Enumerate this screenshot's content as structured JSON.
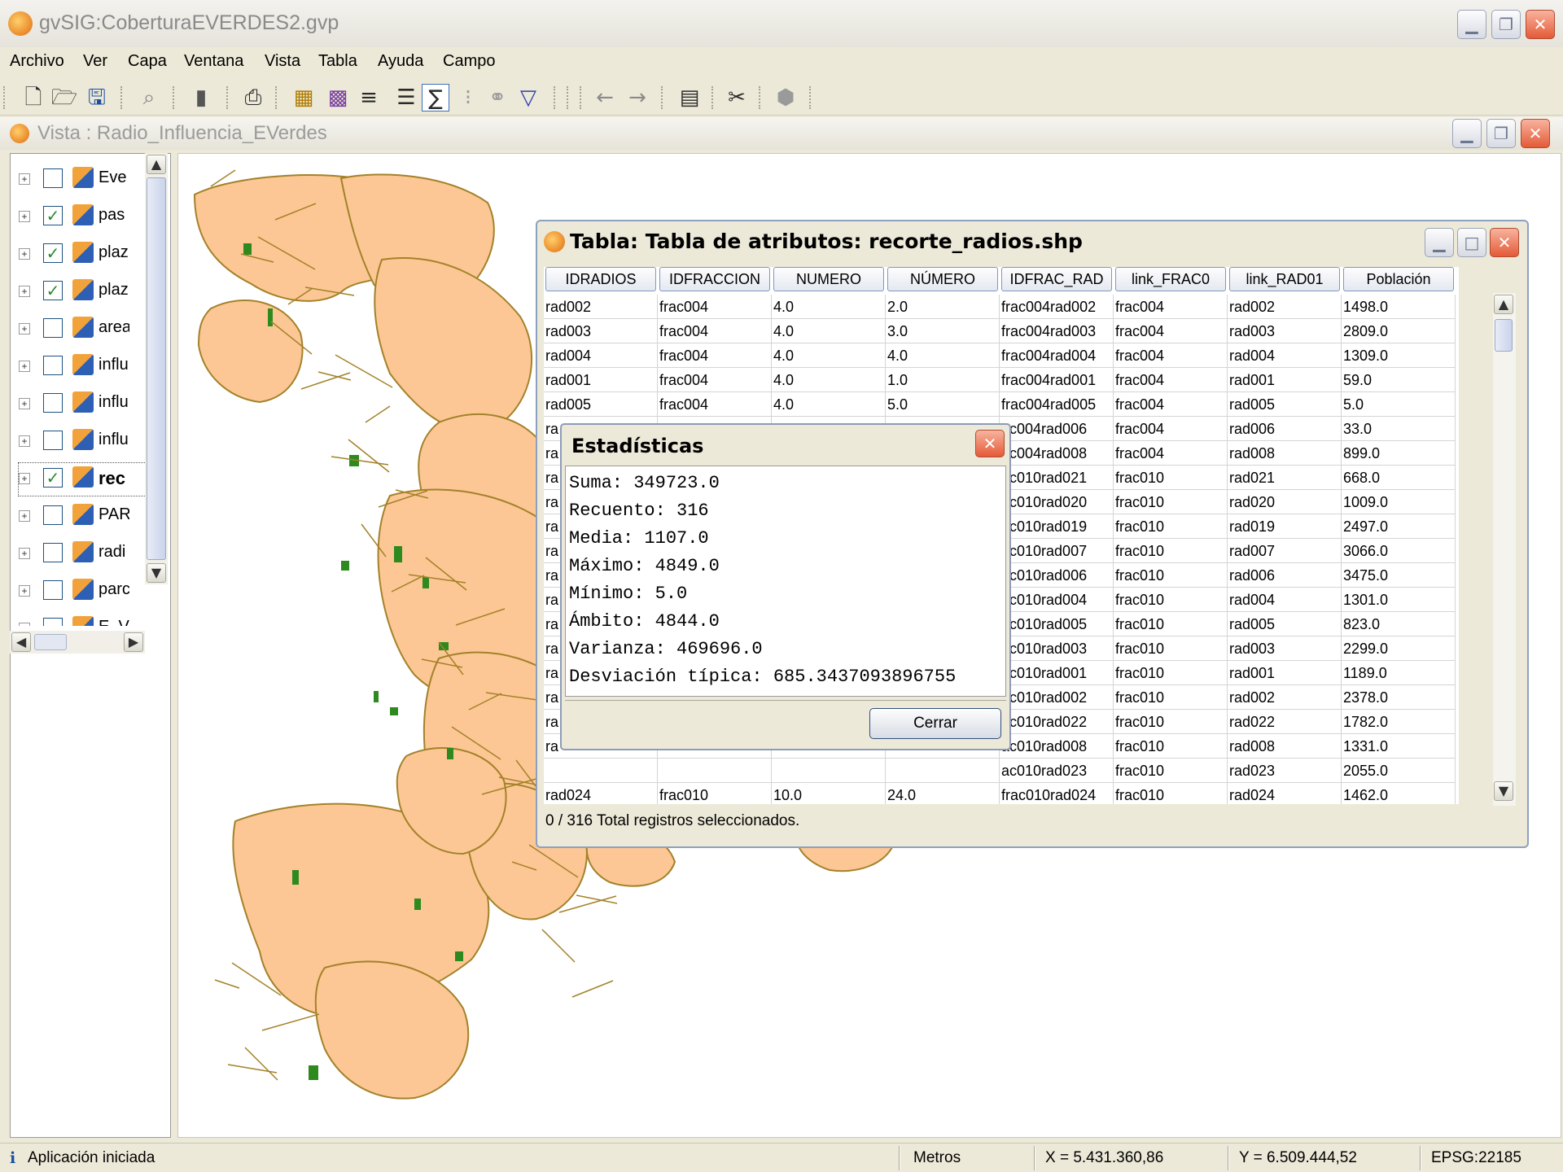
{
  "app": {
    "title": "gvSIG:CoberturaEVERDES2.gvp"
  },
  "menu": [
    "Archivo",
    "Ver",
    "Capa",
    "Ventana",
    "Vista",
    "Tabla",
    "Ayuda",
    "Campo"
  ],
  "view": {
    "title": "Vista : Radio_Influencia_EVerdes"
  },
  "toc": {
    "layers": [
      {
        "label": "Eve",
        "checked": false
      },
      {
        "label": "pas",
        "checked": true
      },
      {
        "label": "plaz",
        "checked": true
      },
      {
        "label": "plaz",
        "checked": true
      },
      {
        "label": "area",
        "checked": false
      },
      {
        "label": "influ",
        "checked": false
      },
      {
        "label": "influ",
        "checked": false
      },
      {
        "label": "influ",
        "checked": false
      },
      {
        "label": "rec",
        "checked": true
      },
      {
        "label": "PAR",
        "checked": false
      },
      {
        "label": "radi",
        "checked": false
      },
      {
        "label": "parc",
        "checked": false
      },
      {
        "label": "E_V",
        "checked": false
      }
    ]
  },
  "table_window": {
    "title": "Tabla: Tabla de atributos: recorte_radios.shp",
    "columns": [
      "IDRADIOS",
      "IDFRACCION",
      "NUMERO",
      "NÚMERO",
      "IDFRAC_RAD",
      "link_FRAC0",
      "link_RAD01",
      "Población"
    ],
    "rows": [
      [
        "rad002",
        "frac004",
        "4.0",
        "2.0",
        "frac004rad002",
        "frac004",
        "rad002",
        "1498.0"
      ],
      [
        "rad003",
        "frac004",
        "4.0",
        "3.0",
        "frac004rad003",
        "frac004",
        "rad003",
        "2809.0"
      ],
      [
        "rad004",
        "frac004",
        "4.0",
        "4.0",
        "frac004rad004",
        "frac004",
        "rad004",
        "1309.0"
      ],
      [
        "rad001",
        "frac004",
        "4.0",
        "1.0",
        "frac004rad001",
        "frac004",
        "rad001",
        "59.0"
      ],
      [
        "rad005",
        "frac004",
        "4.0",
        "5.0",
        "frac004rad005",
        "frac004",
        "rad005",
        "5.0"
      ],
      [
        "ra",
        "",
        "",
        "",
        "ac004rad006",
        "frac004",
        "rad006",
        "33.0"
      ],
      [
        "ra",
        "",
        "",
        "",
        "ac004rad008",
        "frac004",
        "rad008",
        "899.0"
      ],
      [
        "ra",
        "",
        "",
        "",
        "ac010rad021",
        "frac010",
        "rad021",
        "668.0"
      ],
      [
        "ra",
        "",
        "",
        "",
        "ac010rad020",
        "frac010",
        "rad020",
        "1009.0"
      ],
      [
        "ra",
        "",
        "",
        "",
        "ac010rad019",
        "frac010",
        "rad019",
        "2497.0"
      ],
      [
        "ra",
        "",
        "",
        "",
        "ac010rad007",
        "frac010",
        "rad007",
        "3066.0"
      ],
      [
        "ra",
        "",
        "",
        "",
        "ac010rad006",
        "frac010",
        "rad006",
        "3475.0"
      ],
      [
        "ra",
        "",
        "",
        "",
        "ac010rad004",
        "frac010",
        "rad004",
        "1301.0"
      ],
      [
        "ra",
        "",
        "",
        "",
        "ac010rad005",
        "frac010",
        "rad005",
        "823.0"
      ],
      [
        "ra",
        "",
        "",
        "",
        "ac010rad003",
        "frac010",
        "rad003",
        "2299.0"
      ],
      [
        "ra",
        "",
        "",
        "",
        "ac010rad001",
        "frac010",
        "rad001",
        "1189.0"
      ],
      [
        "ra",
        "",
        "",
        "",
        "ac010rad002",
        "frac010",
        "rad002",
        "2378.0"
      ],
      [
        "ra",
        "",
        "",
        "",
        "ac010rad022",
        "frac010",
        "rad022",
        "1782.0"
      ],
      [
        "ra",
        "",
        "",
        "",
        "ac010rad008",
        "frac010",
        "rad008",
        "1331.0"
      ],
      [
        "",
        "",
        "",
        "",
        "ac010rad023",
        "frac010",
        "rad023",
        "2055.0"
      ],
      [
        "rad024",
        "frac010",
        "10.0",
        "24.0",
        "frac010rad024",
        "frac010",
        "rad024",
        "1462.0"
      ]
    ],
    "status": "0 / 316 Total registros seleccionados."
  },
  "stats_dialog": {
    "title": "Estadísticas",
    "lines": [
      "Suma: 349723.0",
      "Recuento: 316",
      "Media: 1107.0",
      "Máximo: 4849.0",
      "Mínimo: 5.0",
      "Ámbito: 4844.0",
      "Varianza: 469696.0",
      "Desviación típica: 685.3437093896755"
    ],
    "close_label": "Cerrar"
  },
  "statusbar": {
    "message": "Aplicación iniciada",
    "units": "Metros",
    "x": "X = 5.431.360,86",
    "y": "Y = 6.509.444,52",
    "crs": "EPSG:22185"
  },
  "colors": {
    "polygon_fill": "#fcc794",
    "polygon_stroke": "#a3822a",
    "green_area": "#2e8a1e"
  }
}
